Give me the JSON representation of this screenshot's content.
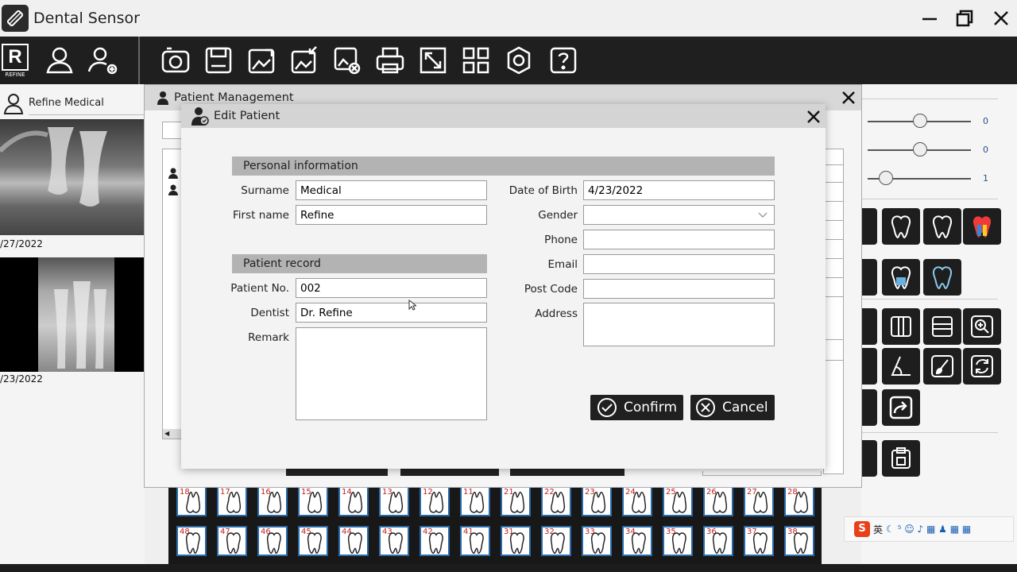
{
  "app": {
    "title": "Dental Sensor"
  },
  "toolbar": {
    "left_icons": [
      "refine-logo-icon",
      "patient-icon",
      "add-patient-icon"
    ],
    "logo_text": "R",
    "logo_sub": "REFINE",
    "tools": [
      "camera-icon",
      "save-icon",
      "export-image-icon",
      "import-image-icon",
      "delete-image-icon",
      "print-icon",
      "fullscreen-icon",
      "layout-grid-icon",
      "settings-icon",
      "help-icon"
    ]
  },
  "left_panel": {
    "patient_name": "Refine Medical",
    "images": [
      {
        "date": "/27/2022"
      },
      {
        "date": "/23/2022"
      }
    ]
  },
  "right_panel": {
    "sliders": [
      {
        "value": "0"
      },
      {
        "value": "0"
      },
      {
        "value": "1"
      }
    ]
  },
  "patient_management": {
    "title": "Patient Management"
  },
  "edit_patient": {
    "title": "Edit Patient",
    "personal_section": "Personal information",
    "record_section": "Patient record",
    "labels": {
      "surname": "Surname",
      "first_name": "First name",
      "patient_no": "Patient No.",
      "dentist": "Dentist",
      "remark": "Remark",
      "dob": "Date of Birth",
      "gender": "Gender",
      "phone": "Phone",
      "email": "Email",
      "post_code": "Post Code",
      "address": "Address"
    },
    "values": {
      "surname": "Medical",
      "first_name": "Refine",
      "patient_no": "002",
      "dentist": "Dr. Refine",
      "remark": "",
      "dob": "4/23/2022",
      "gender": "",
      "phone": "",
      "email": "",
      "post_code": "",
      "address": ""
    },
    "confirm_label": "Confirm",
    "cancel_label": "Cancel"
  },
  "teeth": {
    "upper": [
      "18",
      "17",
      "16",
      "15",
      "14",
      "13",
      "12",
      "11",
      "21",
      "22",
      "23",
      "24",
      "25",
      "26",
      "27",
      "28"
    ],
    "lower": [
      "48",
      "47",
      "46",
      "45",
      "44",
      "43",
      "42",
      "41",
      "31",
      "32",
      "33",
      "34",
      "35",
      "36",
      "37",
      "38"
    ]
  },
  "ime": {
    "label": "英"
  }
}
